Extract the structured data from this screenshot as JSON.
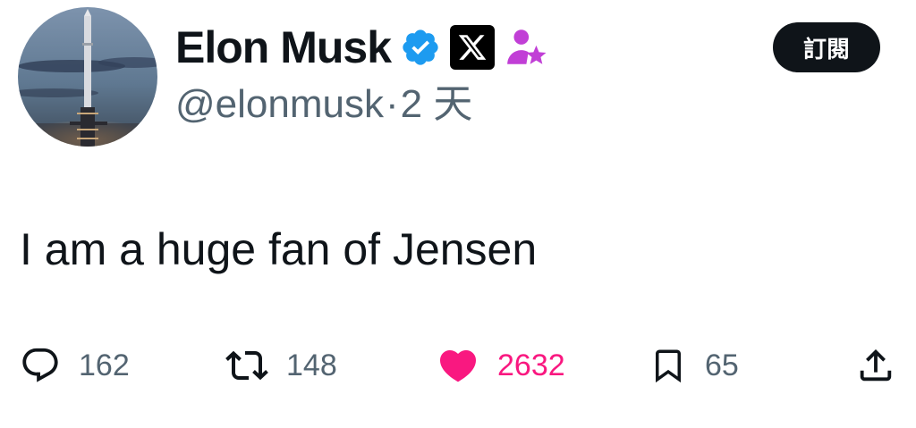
{
  "author": {
    "display_name": "Elon Musk",
    "handle": "@elonmusk",
    "separator": "·",
    "time_ago": "2 天",
    "verified_color": "#1d9bf0",
    "affiliate_badge_icon": "x-logo-icon",
    "subscriber_badge_icon": "person-star-icon",
    "subscriber_badge_color": "#c13fd6"
  },
  "subscribe_button": {
    "label": "訂閱"
  },
  "tweet": {
    "text": "I am a huge fan of Jensen"
  },
  "actions": {
    "replies": "162",
    "retweets": "148",
    "likes": "2632",
    "bookmarks": "65",
    "like_color": "#f91880",
    "muted_color": "#536471"
  }
}
